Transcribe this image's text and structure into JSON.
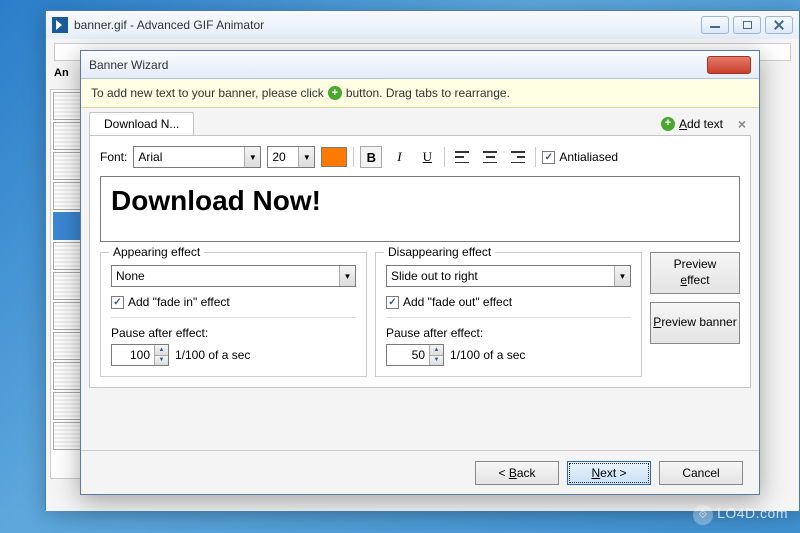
{
  "parent_window": {
    "title": "banner.gif - Advanced GIF Animator",
    "left_label": "An"
  },
  "dialog": {
    "title": "Banner Wizard",
    "info_prefix": "To add new text to your banner, please click",
    "info_suffix": " button. Drag tabs to rearrange.",
    "tab_label": "Download N...",
    "add_text_prefix": "A",
    "add_text_rest": "dd text",
    "font_label": "Font:",
    "font_name": "Arial",
    "font_size": "20",
    "color": "#ff7a00",
    "antialiased_label": "Antialiased",
    "antialiased_checked": true,
    "preview_text": "Download Now!",
    "appearing": {
      "legend": "Appearing effect",
      "effect": "None",
      "fade_label": "Add \"fade in\" effect",
      "fade_checked": true,
      "pause_label": "Pause after effect:",
      "pause_value": "100",
      "pause_unit": "1/100 of a sec"
    },
    "disappearing": {
      "legend": "Disappearing effect",
      "effect": "Slide out to right",
      "fade_label": "Add \"fade out\" effect",
      "fade_checked": true,
      "pause_label": "Pause after effect:",
      "pause_value": "50",
      "pause_unit": "1/100 of a sec"
    },
    "preview_effect_pre": "Preview ",
    "preview_effect_u": "e",
    "preview_effect_post": "ffect",
    "preview_banner_u": "P",
    "preview_banner_post": "review banner",
    "back_pre": "< ",
    "back_u": "B",
    "back_post": "ack",
    "next_u": "N",
    "next_post": "ext >",
    "cancel": "Cancel"
  },
  "watermark": "LO4D.com"
}
